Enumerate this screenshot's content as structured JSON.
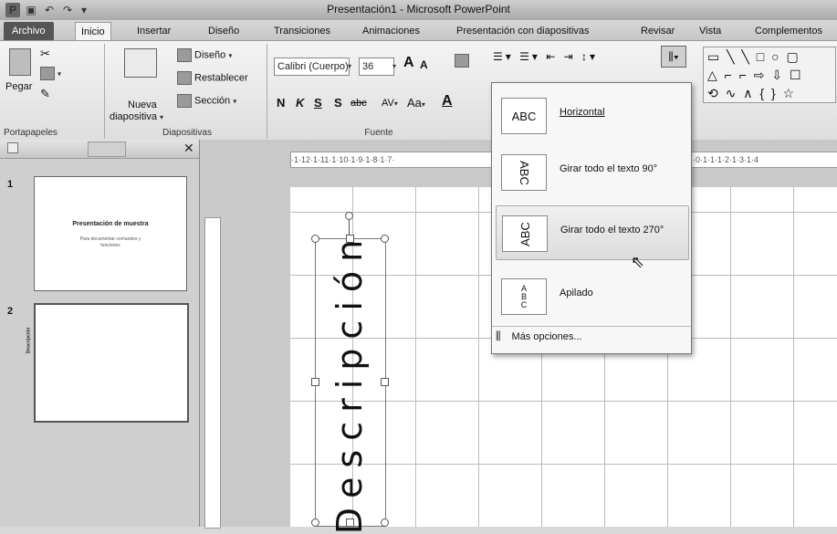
{
  "title_bar": {
    "app_icon": "P",
    "window_title": "Presentación1 - Microsoft PowerPoint",
    "qat_icons": [
      "save-icon",
      "undo-icon",
      "redo-icon",
      "customize-icon"
    ]
  },
  "tabs": [
    "Archivo",
    "Inicio",
    "Insertar",
    "Diseño",
    "Transiciones",
    "Animaciones",
    "Presentación con diapositivas",
    "Revisar",
    "Vista",
    "Complementos"
  ],
  "ribbon": {
    "portapapeles": {
      "label": "Portapapeles",
      "paste": "Pegar"
    },
    "diapositivas": {
      "label": "Diapositivas",
      "new_slide_line1": "Nueva",
      "new_slide_line2": "diapositiva",
      "layout": "Diseño",
      "reset": "Restablecer",
      "section": "Sección"
    },
    "fuente": {
      "label": "Fuente",
      "font_name": "Calibri (Cuerpo)",
      "font_size": "36",
      "grow": "A",
      "shrink": "A",
      "bold": "N",
      "italic": "K",
      "underline": "S",
      "shadow": "S",
      "strike": "abc",
      "spacing": "AV",
      "case": "Aa",
      "color": "A"
    }
  },
  "left_panel": {
    "slide1": {
      "number": "1",
      "title": "Presentación de muestra",
      "subtitle_line1": "Para documentar comandos y",
      "subtitle_line2": "funciones"
    },
    "slide2": {
      "number": "2",
      "text": "Descripción"
    }
  },
  "ruler": {
    "h_text": "·1·12·1·11·1·10·1·9·1·8·1·7·",
    "h_text_right": "·0·1·1·1·2·1·3·1·4"
  },
  "slide": {
    "textbox_text": "Descripción"
  },
  "dropdown": {
    "items": [
      {
        "icon_text": "ABC",
        "label": "Horizontal"
      },
      {
        "icon_text": "ABC",
        "label": "Girar todo el texto 90°"
      },
      {
        "icon_text": "ABC",
        "label": "Girar todo el texto 270°"
      },
      {
        "icon_text": "A B C",
        "label": "Apilado"
      }
    ],
    "more": "Más opciones..."
  }
}
